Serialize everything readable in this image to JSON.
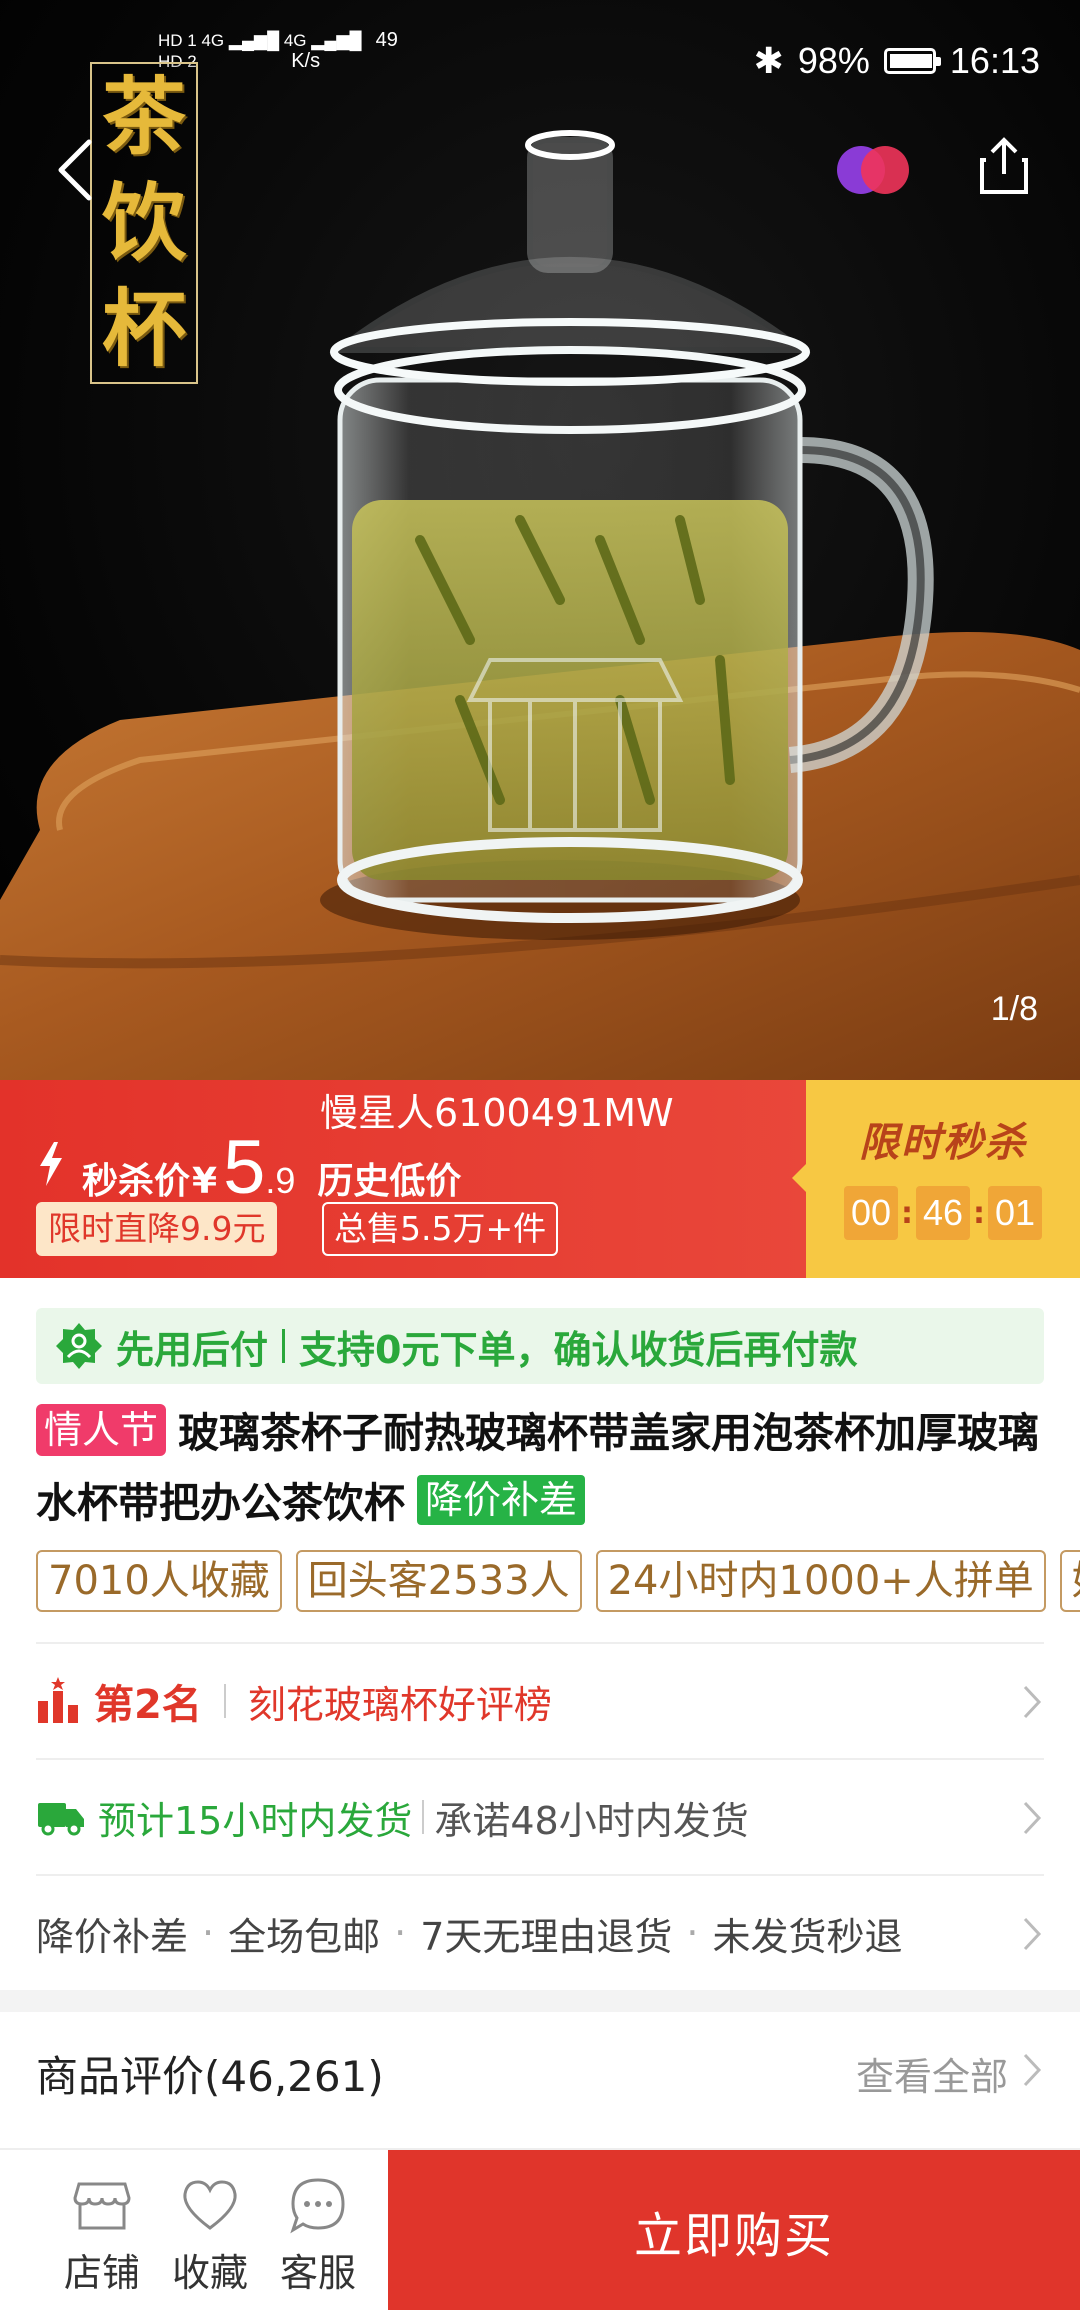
{
  "status_bar": {
    "hd1": "HD 1",
    "hd2": "HD 2",
    "net_type": "4G",
    "speed_value": "49",
    "speed_unit": "K/s",
    "battery": "98%",
    "time": "16:13"
  },
  "hero": {
    "logo_chars": [
      "茶",
      "饮",
      "杯"
    ],
    "page_indicator": "1/8"
  },
  "flash_sale": {
    "seller": "慢星人6100491MW",
    "price_label": "秒杀价",
    "currency": "¥",
    "price_int": "5",
    "price_dec": ".9",
    "price_note": "历史低价",
    "chip_drop": "限时直降9.9元",
    "chip_sold": "总售5.5万+件",
    "title": "限时秒杀",
    "countdown": {
      "h": "00",
      "m": "46",
      "s": "01"
    }
  },
  "pay_later": {
    "label": "先用后付",
    "detail": "支持0元下单，确认收货后再付款"
  },
  "product": {
    "tag_festival": "情人节",
    "title": "玻璃茶杯子耐热玻璃杯带盖家用泡茶杯加厚玻璃水杯带把办公茶饮杯",
    "tag_price": "降价补差"
  },
  "stats": [
    "7010人收藏",
    "回头客2533人",
    "24小时内1000+人拼单",
    "好"
  ],
  "rank": {
    "main": "第2名",
    "list": "刻花玻璃杯好评榜"
  },
  "shipping": {
    "main": "预计15小时内发货",
    "sub": "承诺48小时内发货"
  },
  "services": [
    "降价补差",
    "全场包邮",
    "7天无理由退货",
    "未发货秒退"
  ],
  "reviews": {
    "label": "商品评价(46,261)",
    "see_all": "查看全部"
  },
  "bottom_bar": {
    "shop": "店铺",
    "favorite": "收藏",
    "service": "客服",
    "buy": "立即购买"
  },
  "colors": {
    "accent_red": "#e0352b",
    "flash_yellow": "#f7c843",
    "green": "#2aa83b",
    "tag_pink": "#f03b6a",
    "chip_brown": "#c49a62"
  },
  "icons": [
    "back-arrow-icon",
    "brand-circles-icon",
    "share-icon",
    "bolt-icon",
    "pay-later-icon",
    "rank-chart-icon",
    "truck-icon",
    "chevron-right-icon",
    "shop-icon",
    "heart-icon",
    "chat-icon"
  ]
}
